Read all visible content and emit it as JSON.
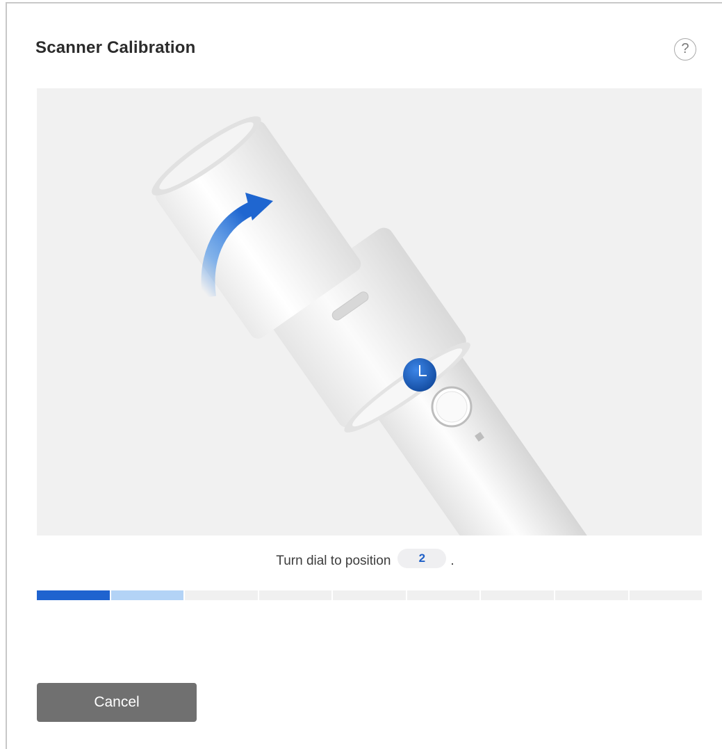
{
  "dialog": {
    "title": "Scanner Calibration",
    "help_icon": "question-circle-icon",
    "help_glyph": "?"
  },
  "illustration": {
    "description_icon": "scanner-rotate-illustration",
    "arrow_icon": "rotate-arrow-icon",
    "arrow_color": "#2f7fe0",
    "dial_color": "#1e5fc7"
  },
  "instruction": {
    "prefix": "Turn dial to position",
    "position_value": "2",
    "suffix": "."
  },
  "progress": {
    "total_segments": 9,
    "completed_segments": 1,
    "active_segment": 2,
    "done_color": "#1f63cf",
    "active_color": "#b3d3f6",
    "pending_color": "#f0f0f0"
  },
  "actions": {
    "cancel_label": "Cancel"
  }
}
